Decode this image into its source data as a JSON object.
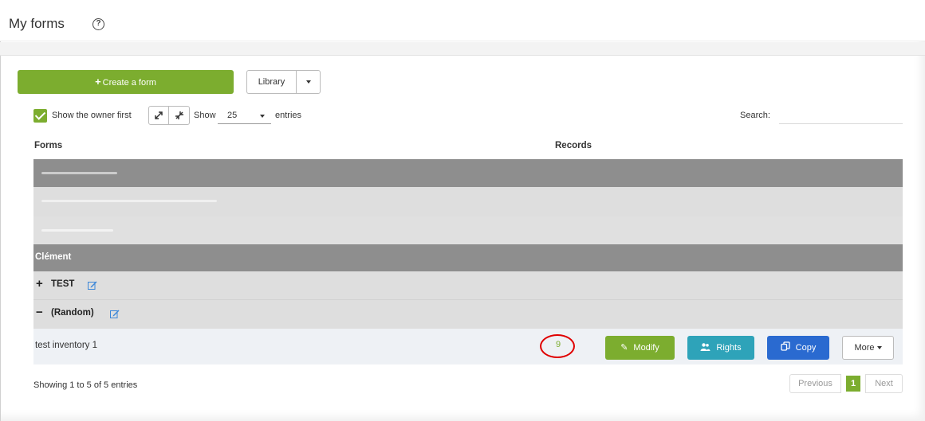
{
  "header": {
    "title": "My forms",
    "help_icon": "?"
  },
  "toolbar": {
    "create_label": "Create a form",
    "create_icon": "+",
    "library_label": "Library",
    "show_owner_first_label": "Show the owner first",
    "show_owner_first_checked": true,
    "show_label": "Show",
    "entries_value": "25",
    "entries_label": "entries",
    "search_label": "Search:",
    "search_value": ""
  },
  "table": {
    "columns": {
      "forms": "Forms",
      "records": "Records"
    },
    "owners": [
      {
        "name": "Clément",
        "folders": [
          {
            "sign": "+",
            "name": "TEST",
            "expanded": false
          },
          {
            "sign": "−",
            "name": "(Random)",
            "expanded": true,
            "forms": [
              {
                "name": "test inventory 1",
                "records": "9"
              }
            ]
          }
        ]
      }
    ],
    "actions": {
      "modify": "Modify",
      "rights": "Rights",
      "copy": "Copy",
      "more": "More"
    }
  },
  "footer": {
    "showing": "Showing 1 to 5 of 5 entries",
    "prev": "Previous",
    "current_page": "1",
    "next": "Next"
  },
  "colors": {
    "accent_green": "#7cad2f",
    "rights_teal": "#2ea3b9",
    "copy_blue": "#2a6ad0",
    "group_dark": "#8e8e8e",
    "group_light": "#dedede",
    "highlight_circle": "#e00000"
  }
}
